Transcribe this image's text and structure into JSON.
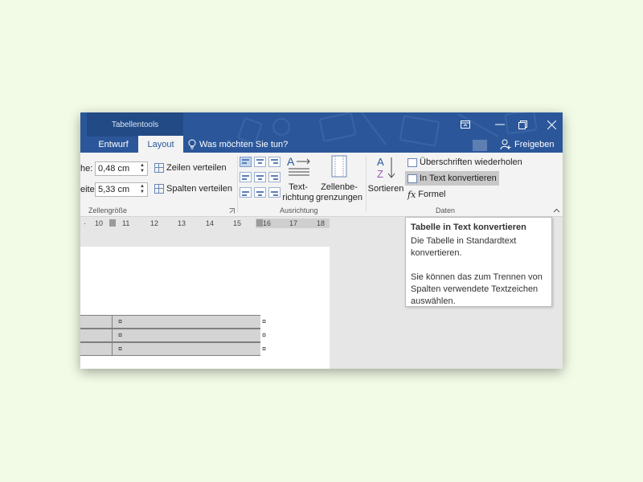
{
  "window": {
    "context_tab": "Tabellentools",
    "tabs": [
      "Entwurf",
      "Layout"
    ],
    "active_tab": "Layout",
    "tell_me": "Was möchten Sie tun?",
    "share": "Freigeben",
    "accent": "#2b579a"
  },
  "ribbon": {
    "cell_size": {
      "height_label": "he:",
      "height_value": "0,48 cm",
      "width_label": "eite:",
      "width_value": "5,33 cm",
      "distribute_rows": "Zeilen verteilen",
      "distribute_cols": "Spalten verteilen",
      "group_label": "Zellengröße"
    },
    "alignment": {
      "text_direction_1": "Text-",
      "text_direction_2": "richtung",
      "cell_margins_1": "Zellenbe-",
      "cell_margins_2": "grenzungen",
      "group_label": "Ausrichtung"
    },
    "data": {
      "sort": "Sortieren",
      "repeat_headers": "Überschriften wiederholen",
      "convert_to_text": "In Text konvertieren",
      "formula": "Formel",
      "group_label": "Daten"
    }
  },
  "ruler": {
    "ticks": [
      "10",
      "11",
      "12",
      "13",
      "14",
      "15",
      "16",
      "17",
      "18"
    ]
  },
  "document": {
    "cell_marker": "¤"
  },
  "tooltip": {
    "title": "Tabelle in Text konvertieren",
    "line1": "Die Tabelle in Standardtext konvertieren.",
    "line2": "Sie können das zum Trennen von Spalten verwendete Textzeichen auswählen."
  }
}
